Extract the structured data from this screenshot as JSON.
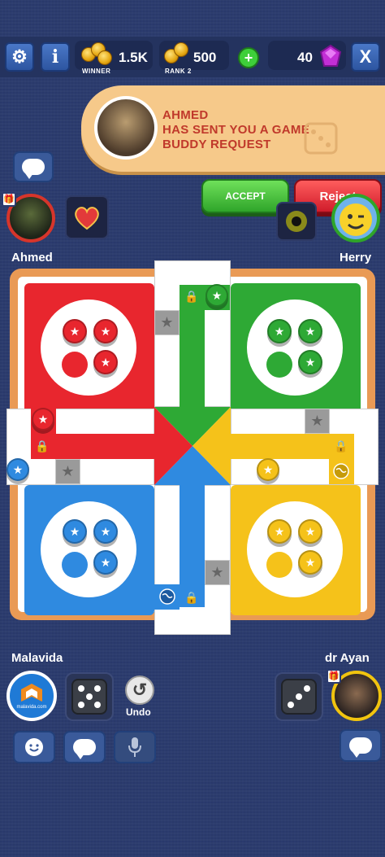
{
  "topbar": {
    "settings_icon": "gear-icon",
    "info_label": "i",
    "winner_coins": "1.5K",
    "winner_label": "WINNER",
    "rank_coins": "500",
    "rank_label": "RANK 2",
    "add_label": "+",
    "gems": "40",
    "close_label": "X"
  },
  "notification": {
    "line1": "Ahmed",
    "line2": "has sent you a game",
    "line3": "buddy request",
    "accept_label": "Accept",
    "reject_label": "Reject"
  },
  "players": {
    "top_left": {
      "name": "Ahmed",
      "color": "#d6352b"
    },
    "top_right": {
      "name": "Herry",
      "color": "#2fa52a"
    },
    "bottom_left": {
      "name": "Malavida",
      "color": "#2f7fd8",
      "avatar_text": "malavida.com"
    },
    "bottom_right": {
      "name": "dr Ayan",
      "color": "#f1c40f"
    }
  },
  "controls": {
    "undo_label": "Undo"
  },
  "board": {
    "colors": {
      "red": "#e8262e",
      "green": "#2ea935",
      "yellow": "#f5c21a",
      "blue": "#2f8ae0"
    }
  }
}
